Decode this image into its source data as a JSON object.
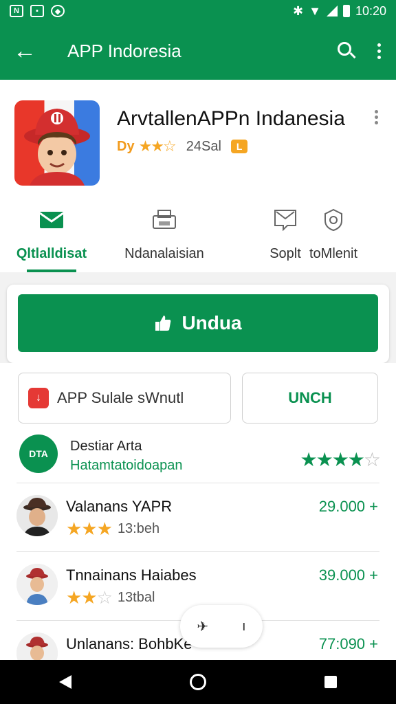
{
  "status_bar": {
    "time": "10:20",
    "left_icons": [
      "notification-icon",
      "image-icon",
      "location-icon"
    ],
    "right_icons": [
      "settings-icon",
      "wifi-icon",
      "signal-icon",
      "battery-icon"
    ]
  },
  "app_bar": {
    "title": "APP Indoresia",
    "back_icon": "arrow-back-icon",
    "actions": [
      "search-icon",
      "more-vert-icon"
    ]
  },
  "app_header": {
    "name": "ArvtallenAPPn Indanesia",
    "developer": "Dy",
    "stars": "★★☆",
    "rating_count": "24Sal",
    "badge": "L"
  },
  "tabs": [
    {
      "label": "Qltlalldisat",
      "icon": "mail-icon",
      "active": true
    },
    {
      "label": "Ndanalaisian",
      "icon": "printer-icon",
      "active": false
    },
    {
      "label": "Soplt",
      "icon": "message-icon",
      "active": false
    },
    {
      "label": "toMlenit",
      "icon": "shield-icon",
      "active": false
    }
  ],
  "install": {
    "label": "Undua",
    "icon": "thumb-up-icon"
  },
  "secondary_buttons": {
    "left_label": "APP Sulale sWnutl",
    "left_icon": "app-badge-icon",
    "right_label": "UNCH"
  },
  "developer_row": {
    "logo_text": "DTA",
    "name": "Destiar Arta",
    "subtitle": "Hatamtatoidoapan",
    "stars_filled": "★★★★",
    "stars_empty": "☆",
    "rating_value": 4
  },
  "items": [
    {
      "name": "Valanans YAPR",
      "stars_filled": "★★★",
      "stars_empty": "",
      "meta": "13:beh",
      "price": "29.000 +"
    },
    {
      "name": "Tnnainans Haiabes",
      "stars_filled": "★★",
      "stars_empty": "☆",
      "meta": "13tbal",
      "price": "39.000 +"
    },
    {
      "name": "Unlanans: BohbKe",
      "stars_filled": "",
      "stars_empty": "",
      "meta": "",
      "price": "77:090 +"
    }
  ],
  "colors": {
    "primary": "#0a9150",
    "star": "#f5a623",
    "background": "#f2f2f2"
  }
}
